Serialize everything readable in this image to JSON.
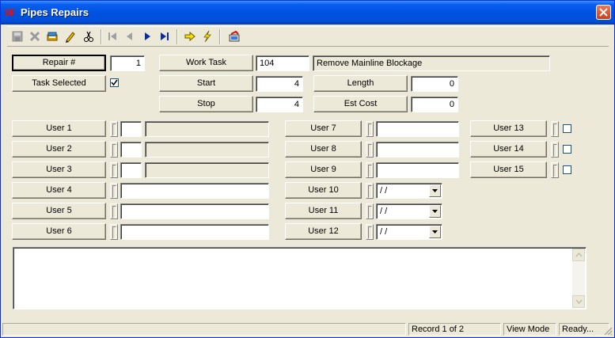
{
  "window": {
    "title": "Pipes Repairs",
    "app_icon_text": "RF"
  },
  "toolbar": {
    "buttons": [
      {
        "name": "save-icon"
      },
      {
        "name": "delete-icon"
      },
      {
        "name": "book-icon"
      },
      {
        "name": "pencil-icon"
      },
      {
        "name": "scissors-icon"
      },
      {
        "name": "first-record-icon"
      },
      {
        "name": "previous-record-icon"
      },
      {
        "name": "next-record-icon"
      },
      {
        "name": "last-record-icon"
      },
      {
        "name": "arrow-right-icon"
      },
      {
        "name": "lightning-icon"
      },
      {
        "name": "refresh-icon"
      }
    ]
  },
  "form": {
    "repair_label": "Repair #",
    "repair_value": "1",
    "task_selected_label": "Task Selected",
    "task_selected_checked": true,
    "work_task_label": "Work Task",
    "work_task_code": "104",
    "work_task_desc": "Remove Mainline Blockage",
    "start_label": "Start",
    "start_value": "4",
    "stop_label": "Stop",
    "stop_value": "4",
    "length_label": "Length",
    "length_value": "0",
    "est_cost_label": "Est Cost",
    "est_cost_value": "0"
  },
  "users": {
    "u1": {
      "label": "User 1",
      "value": "",
      "desc": ""
    },
    "u2": {
      "label": "User 2",
      "value": "",
      "desc": ""
    },
    "u3": {
      "label": "User 3",
      "value": "",
      "desc": ""
    },
    "u4": {
      "label": "User 4",
      "value": ""
    },
    "u5": {
      "label": "User 5",
      "value": ""
    },
    "u6": {
      "label": "User 6",
      "value": ""
    },
    "u7": {
      "label": "User 7",
      "value": ""
    },
    "u8": {
      "label": "User 8",
      "value": ""
    },
    "u9": {
      "label": "User 9",
      "value": ""
    },
    "u10": {
      "label": "User 10",
      "value": " / /"
    },
    "u11": {
      "label": "User 11",
      "value": " / /"
    },
    "u12": {
      "label": "User 12",
      "value": " / /"
    },
    "u13": {
      "label": "User 13",
      "checked": false
    },
    "u14": {
      "label": "User 14",
      "checked": false
    },
    "u15": {
      "label": "User 15",
      "checked": false
    }
  },
  "notes": {
    "value": ""
  },
  "status": {
    "blank": "",
    "record": "Record 1 of 2",
    "mode": "View Mode",
    "state": "Ready..."
  },
  "colors": {
    "titlebar": "#0053e1",
    "face": "#ece9d8",
    "close": "#c4411d"
  }
}
